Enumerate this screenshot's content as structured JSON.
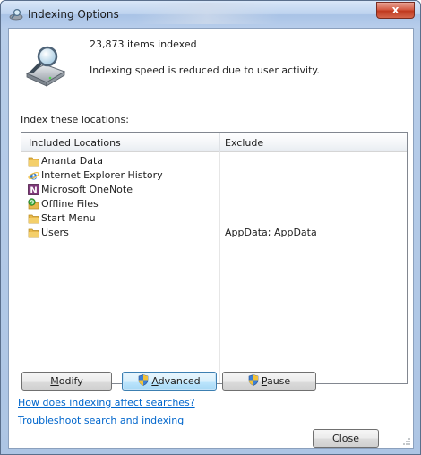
{
  "window": {
    "title": "Indexing Options",
    "close_glyph": "x"
  },
  "status": {
    "items_indexed": "23,873 items indexed",
    "speed_message": "Indexing speed is reduced due to user activity."
  },
  "locations": {
    "section_label": "Index these locations:",
    "columns": {
      "included": "Included Locations",
      "exclude": "Exclude"
    },
    "rows": [
      {
        "name": "Ananta Data",
        "exclude": "",
        "icon": "folder-icon"
      },
      {
        "name": "Internet Explorer History",
        "exclude": "",
        "icon": "internet-explorer-icon"
      },
      {
        "name": "Microsoft OneNote",
        "exclude": "",
        "icon": "onenote-icon"
      },
      {
        "name": "Offline Files",
        "exclude": "",
        "icon": "offline-files-icon"
      },
      {
        "name": "Start Menu",
        "exclude": "",
        "icon": "folder-icon"
      },
      {
        "name": "Users",
        "exclude": "AppData; AppData",
        "icon": "folder-icon"
      }
    ]
  },
  "buttons": {
    "modify": {
      "pre": "",
      "ul": "M",
      "post": "odify"
    },
    "advanced": {
      "pre": "",
      "ul": "A",
      "post": "dvanced"
    },
    "pause": {
      "pre": "",
      "ul": "P",
      "post": "ause"
    },
    "close": "Close"
  },
  "links": {
    "how_affect": "How does indexing affect searches?",
    "troubleshoot": "Troubleshoot search and indexing"
  },
  "colors": {
    "link": "#0066cc",
    "folder": "#e8b84a",
    "onenote": "#80397b",
    "close_button": "#c0391f"
  }
}
